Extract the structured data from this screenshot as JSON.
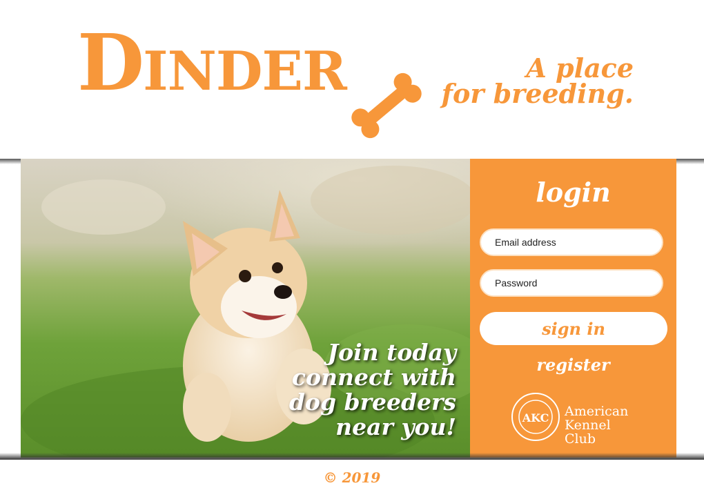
{
  "header": {
    "logo_first": "D",
    "logo_rest": "INDER",
    "tagline_line1": "A place",
    "tagline_line2": "for breeding."
  },
  "hero": {
    "promo_line1": "Join today",
    "promo_line2": "connect with",
    "promo_line3": "dog breeders",
    "promo_line4": "near you!"
  },
  "login": {
    "title": "login",
    "email_placeholder": "Email address",
    "password_placeholder": "Password",
    "signin_label": "sign in",
    "register_label": "register"
  },
  "akc": {
    "line1": "American",
    "line2": "Kennel Club"
  },
  "footer": {
    "copyright": "© 2019"
  },
  "colors": {
    "brand": "#f7973a",
    "text_on_brand": "#ffffff"
  }
}
